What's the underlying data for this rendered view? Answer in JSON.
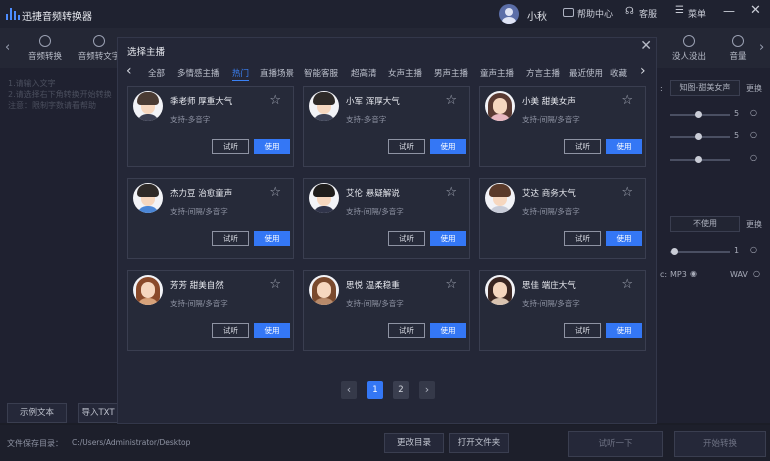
{
  "app": {
    "title": "迅捷音频转换器"
  },
  "titlebar": {
    "user": "小秋",
    "help": "帮助中心",
    "service": "客服",
    "menu": "菜单"
  },
  "nav": [
    {
      "label": "音频转换"
    },
    {
      "label": "音频转文字"
    },
    {
      "label": "没人没出"
    },
    {
      "label": "音量"
    }
  ],
  "left": {
    "hints": [
      "1.请输入文字",
      "2.请选择右下角转换开始转换",
      "注意：限制字数请看帮助"
    ],
    "example_button": "示例文本",
    "import_button": "导入TXT"
  },
  "right": {
    "anchor_label": "知图-甜美女声",
    "change": "更换",
    "values": [
      "5",
      "5"
    ],
    "dropdown": "不使用",
    "volume_value": "1",
    "format_mp3": "MP3",
    "format_wav": "WAV"
  },
  "bottom": {
    "save_label": "文件保存目录：",
    "save_path": "C:/Users/Administrator/Desktop",
    "change_dir": "更改目录",
    "open_folder": "打开文件夹",
    "try_listen": "试听一下",
    "start": "开始转换"
  },
  "modal": {
    "title": "选择主播",
    "tabs": [
      "全部",
      "多情感主播",
      "热门",
      "直播场景",
      "智能客服",
      "超高清",
      "女声主播",
      "男声主播",
      "童声主播",
      "方言主播",
      "最近使用",
      "收藏"
    ],
    "active_tab": "热门",
    "listen_label": "试听",
    "use_label": "使用",
    "anchors": [
      {
        "name": "季老师 厚重大气",
        "support": "支持-多音字"
      },
      {
        "name": "小军 浑厚大气",
        "support": "支持-多音字"
      },
      {
        "name": "小美 甜美女声",
        "support": "支持-间隔/多音字"
      },
      {
        "name": "杰力豆 治愈童声",
        "support": "支持-间隔/多音字"
      },
      {
        "name": "艾伦 悬疑解说",
        "support": "支持-间隔/多音字"
      },
      {
        "name": "艾达 商务大气",
        "support": "支持-间隔/多音字"
      },
      {
        "name": "芳芳 甜美自然",
        "support": "支持-间隔/多音字"
      },
      {
        "name": "思悦 温柔稳重",
        "support": "支持-间隔/多音字"
      },
      {
        "name": "思佳 端庄大气",
        "support": "支持-间隔/多音字"
      }
    ],
    "pages": [
      "1",
      "2"
    ],
    "current_page": "1",
    "colors": {
      "accent": "#3477f5"
    }
  }
}
